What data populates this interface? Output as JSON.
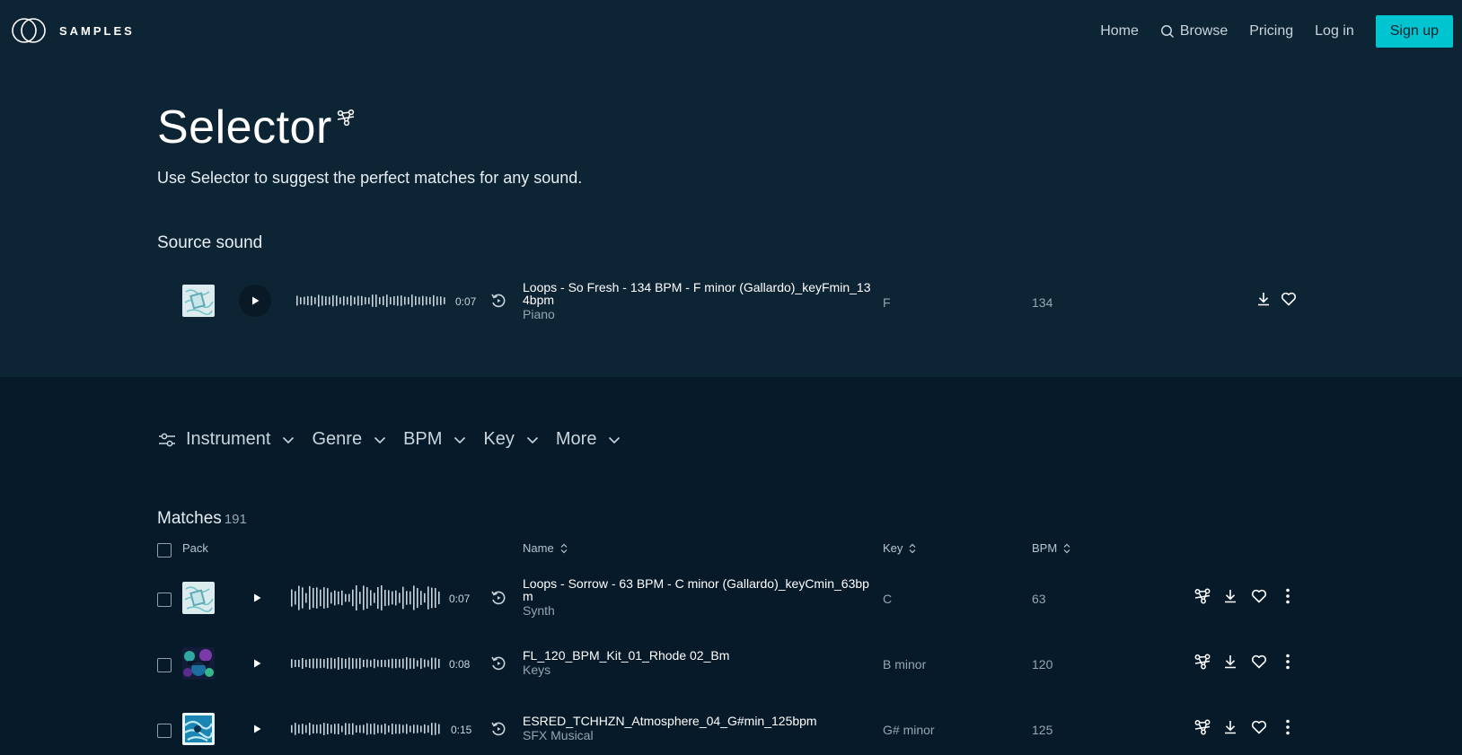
{
  "nav": {
    "logo_text": "SAMPLES",
    "links": [
      "Home",
      "Browse",
      "Pricing",
      "Log in"
    ],
    "signup": "Sign up"
  },
  "hero": {
    "title": "Selector",
    "subtitle": "Use Selector to suggest the perfect matches for any sound.",
    "source_label": "Source sound"
  },
  "source": {
    "duration": "0:07",
    "name": "Loops - So Fresh - 134 BPM - F minor (Gallardo)_keyFmin_134bpm",
    "instrument": "Piano",
    "key": "F",
    "bpm": "134"
  },
  "filters": [
    "Instrument",
    "Genre",
    "BPM",
    "Key",
    "More"
  ],
  "matches": {
    "title": "Matches",
    "count": "191",
    "headers": {
      "pack": "Pack",
      "name": "Name",
      "key": "Key",
      "bpm": "BPM"
    },
    "rows": [
      {
        "duration": "0:07",
        "name": "Loops - Sorrow - 63 BPM - C minor (Gallardo)_keyCmin_63bpm",
        "instrument": "Synth",
        "key": "C",
        "bpm": "63"
      },
      {
        "duration": "0:08",
        "name": "FL_120_BPM_Kit_01_Rhode 02_Bm",
        "instrument": "Keys",
        "key": "B minor",
        "bpm": "120"
      },
      {
        "duration": "0:15",
        "name": "ESRED_TCHHZN_Atmosphere_04_G#min_125bpm",
        "instrument": "SFX Musical",
        "key": "G# minor",
        "bpm": "125"
      }
    ]
  },
  "colors": {
    "accent": "#00c4cf",
    "top_bg": "#0d2434",
    "bottom_bg": "#071a29"
  }
}
